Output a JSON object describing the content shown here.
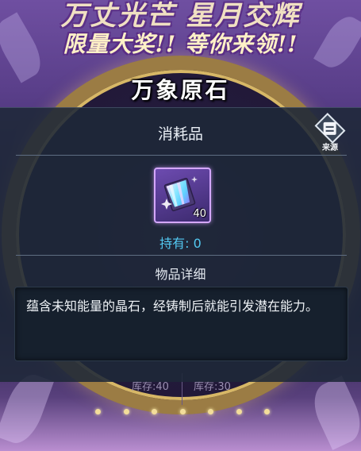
{
  "event_banner": {
    "line1": "万丈光芒 星月交辉",
    "line2": "限量大奖!! 等你来领!!"
  },
  "item": {
    "name": "万象原石",
    "category": "消耗品",
    "quantity_badge": "40",
    "owned": "持有: 0",
    "details_heading": "物品详细",
    "description": "蕴含未知能量的晶石，经铸制后就能引发潜在能力。"
  },
  "source_button": {
    "label": "来源",
    "icon": "list-icon"
  },
  "wheel": {
    "stock_left": "库存:40",
    "stock_right": "库存:30"
  },
  "colors": {
    "owned_text": "#53c9f2",
    "icon_frame": "#d4a7ff",
    "panel": "#1e2838"
  }
}
